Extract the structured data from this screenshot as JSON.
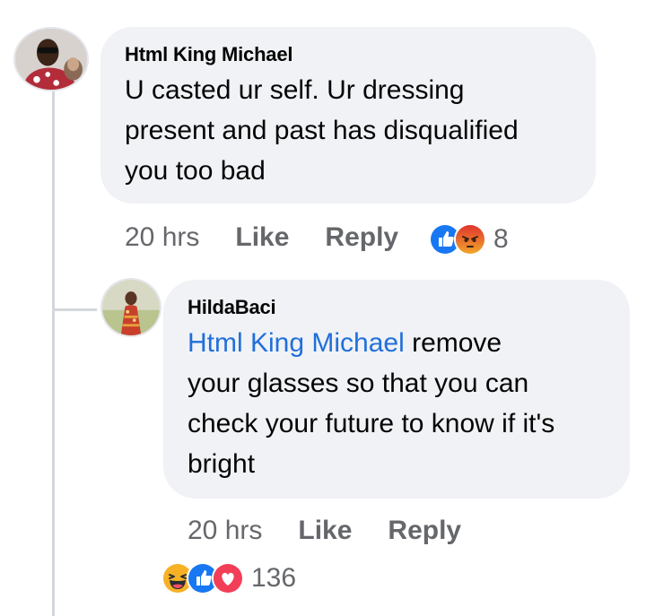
{
  "comment": {
    "author": "Html King Michael",
    "text_lines": [
      "U casted ur self. Ur dressing",
      "present and past has disqualified",
      "you too bad"
    ],
    "time": "20 hrs",
    "like_label": "Like",
    "reply_label": "Reply",
    "reactions": [
      "like",
      "angry"
    ],
    "reaction_count": "8"
  },
  "reply": {
    "author": "HildaBaci",
    "mention": "Html King Michael",
    "text_first_rest": " remove",
    "text_lines": [
      "your glasses so that you can",
      "check your future to know if it's",
      "bright"
    ],
    "time": "20 hrs",
    "like_label": "Like",
    "reply_label": "Reply",
    "reactions": [
      "haha",
      "like",
      "love"
    ],
    "reaction_count": "136"
  },
  "colors": {
    "bubble": "#f0f2f5",
    "meta_text": "#65676b",
    "mention": "#216fdb",
    "like_blue": "#1877f2",
    "angry_orange": "#e9710f",
    "love_red": "#f33e58",
    "haha_yellow": "#f7b125"
  }
}
